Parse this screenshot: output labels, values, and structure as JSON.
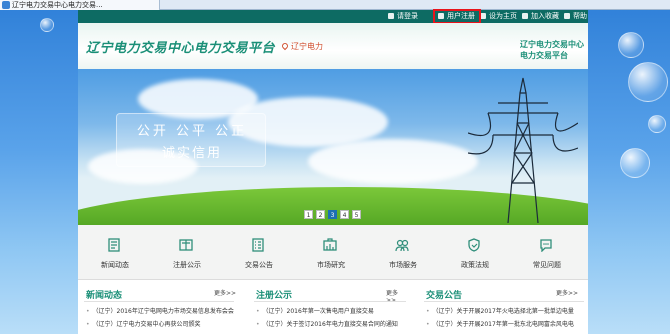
{
  "browser": {
    "tab_title": "辽宁电力交易中心电力交易..."
  },
  "topbar": {
    "login": "请登录",
    "register": "用户注册",
    "set_home": "设为主页",
    "favorite": "加入收藏",
    "help": "帮助"
  },
  "header": {
    "site_title": "辽宁电力交易中心电力交易平台",
    "region": "辽宁电力",
    "right_title_line1": "辽宁电力交易中心",
    "right_title_line2": "电力交易平台"
  },
  "banner": {
    "slogan_line1": "公开 公平 公正",
    "slogan_line2": "诚实信用",
    "pages": [
      "1",
      "2",
      "3",
      "4",
      "5"
    ],
    "active_page": 3
  },
  "nav": [
    {
      "label": "新闻动态",
      "icon": "news-icon"
    },
    {
      "label": "注册公示",
      "icon": "registration-icon"
    },
    {
      "label": "交易公告",
      "icon": "announcement-icon"
    },
    {
      "label": "市场研究",
      "icon": "research-icon"
    },
    {
      "label": "市场服务",
      "icon": "service-icon"
    },
    {
      "label": "政策法规",
      "icon": "policy-icon"
    },
    {
      "label": "常见问题",
      "icon": "faq-icon"
    }
  ],
  "columns": [
    {
      "title": "新闻动态",
      "more": "更多>>",
      "items": [
        "（辽宁）2016年辽宁电网电力市场交易信息发布会会",
        "（辽宁）辽宁电力交易中心再获公司颁奖"
      ]
    },
    {
      "title": "注册公示",
      "more": "更多>>",
      "items": [
        "（辽宁）2016年第一次售电用户直接交易",
        "（辽宁）关于签订2016年电力直接交易合同的通知"
      ]
    },
    {
      "title": "交易公告",
      "more": "更多>>",
      "items": [
        "（辽宁）关于开展2017年火电选择北第一批单边电量",
        "（辽宁）关于开展2017年第一批东北电网富余风电电"
      ]
    }
  ],
  "colors": {
    "brand_green": "#1a8f77",
    "topbar_bg": "#0d6b63",
    "highlight_red": "#e8141b",
    "page_active": "#1d6fb3"
  }
}
